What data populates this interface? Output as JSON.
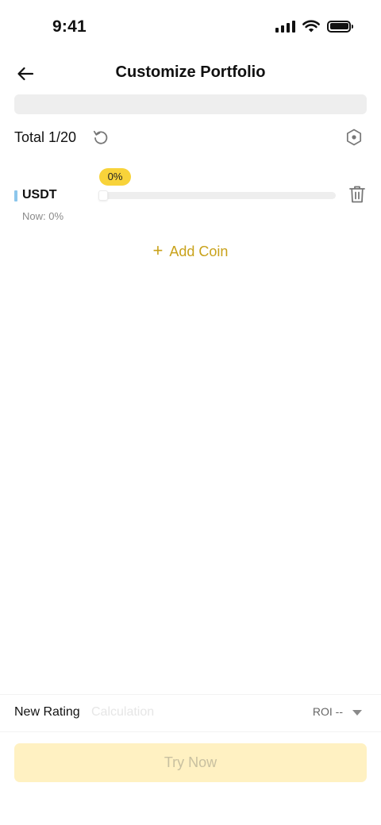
{
  "status_bar": {
    "time": "9:41"
  },
  "header": {
    "title": "Customize Portfolio"
  },
  "total": {
    "label": "Total",
    "count": "1/20"
  },
  "coins": [
    {
      "name": "USDT",
      "allocation_label": "0%",
      "allocation_percent": 0,
      "now_label": "Now: 0%",
      "marker_color": "#8cc6ec"
    }
  ],
  "add_coin": {
    "plus": "+",
    "label": "Add Coin"
  },
  "rating": {
    "label": "New Rating",
    "calculation": "Calculation",
    "roi": "ROI --"
  },
  "action": {
    "try_label": "Try Now"
  },
  "colors": {
    "accent": "#c9a21b",
    "badge": "#f8d33a",
    "button_bg": "#fff1c2",
    "button_text": "#c8c0a0"
  },
  "icons": {
    "back": "arrow-left-icon",
    "reset": "reset-icon",
    "settings": "hexagon-settings-icon",
    "delete": "trash-icon",
    "dropdown": "caret-down-icon"
  }
}
